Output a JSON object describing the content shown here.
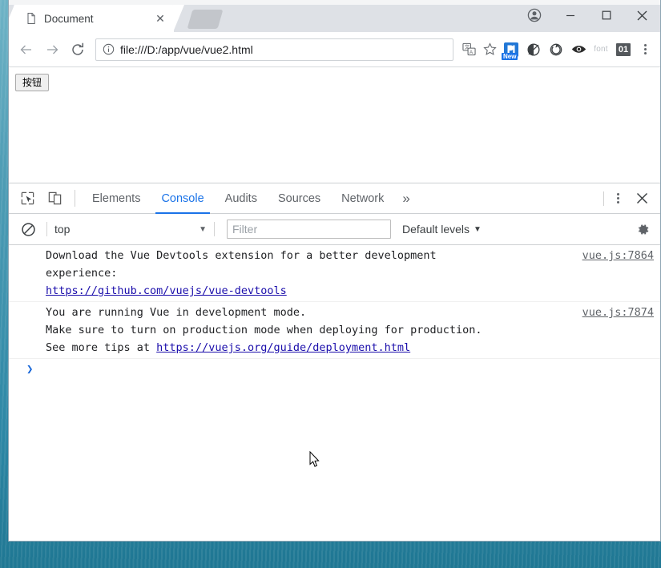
{
  "window": {
    "controls": {
      "avatar": "profile-avatar",
      "minimize": "—",
      "maximize": "▢",
      "close": "✕"
    }
  },
  "tabstrip": {
    "tabs": [
      {
        "title": "Document",
        "favicon": "page-icon",
        "close": "✕",
        "active": true
      }
    ],
    "new_tab_label": ""
  },
  "toolbar": {
    "back": "←",
    "forward": "→",
    "reload": "⟳",
    "omnibox": {
      "security_icon": "info-icon",
      "url": "file:///D:/app/vue/vue2.html"
    },
    "translate_icon": "translate-icon",
    "bookmark_icon": "star-icon",
    "extensions": [
      {
        "name": "vue-devtools-icon",
        "badge": "New"
      },
      {
        "name": "moon-icon",
        "badge": ""
      },
      {
        "name": "refresh-circle-icon",
        "badge": ""
      },
      {
        "name": "eye-icon",
        "badge": ""
      },
      {
        "name": "font-icon",
        "label": "font"
      },
      {
        "name": "zero-one-icon",
        "label": "01"
      }
    ],
    "menu_icon": "kebab-menu-icon"
  },
  "page": {
    "button_label": "按钮"
  },
  "devtools": {
    "tools": {
      "inspect": "inspect-element-icon",
      "device": "device-toolbar-icon"
    },
    "tabs": [
      {
        "label": "Elements",
        "active": false
      },
      {
        "label": "Console",
        "active": true
      },
      {
        "label": "Audits",
        "active": false
      },
      {
        "label": "Sources",
        "active": false
      },
      {
        "label": "Network",
        "active": false
      }
    ],
    "more_tabs": "»",
    "menu_icon": "devtools-menu-icon",
    "close_icon": "✕",
    "filterbar": {
      "clear_icon": "clear-console-icon",
      "context": "top",
      "context_caret": "▼",
      "filter_placeholder": "Filter",
      "filter_value": "",
      "levels_label": "Default levels",
      "levels_caret": "▼",
      "settings_icon": "gear-icon"
    },
    "console": {
      "messages": [
        {
          "lines": [
            {
              "text": "Download the Vue Devtools extension for a better development",
              "type": "text"
            },
            {
              "text": "experience:",
              "type": "text"
            },
            {
              "text": "https://github.com/vuejs/vue-devtools",
              "type": "link"
            }
          ],
          "source": "vue.js:7864"
        },
        {
          "lines": [
            {
              "text": "You are running Vue in development mode.",
              "type": "text"
            },
            {
              "text": "Make sure to turn on production mode when deploying for production.",
              "type": "text"
            },
            {
              "text": "See more tips at ",
              "type": "text",
              "link_tail": "https://vuejs.org/guide/deployment.html"
            }
          ],
          "source": "vue.js:7874"
        }
      ],
      "prompt_caret": "❯"
    }
  },
  "colors": {
    "accent": "#1a73e8",
    "tabstrip_bg": "#dee1e6",
    "link": "#1a0dab",
    "desktop": "#3f93ad"
  }
}
